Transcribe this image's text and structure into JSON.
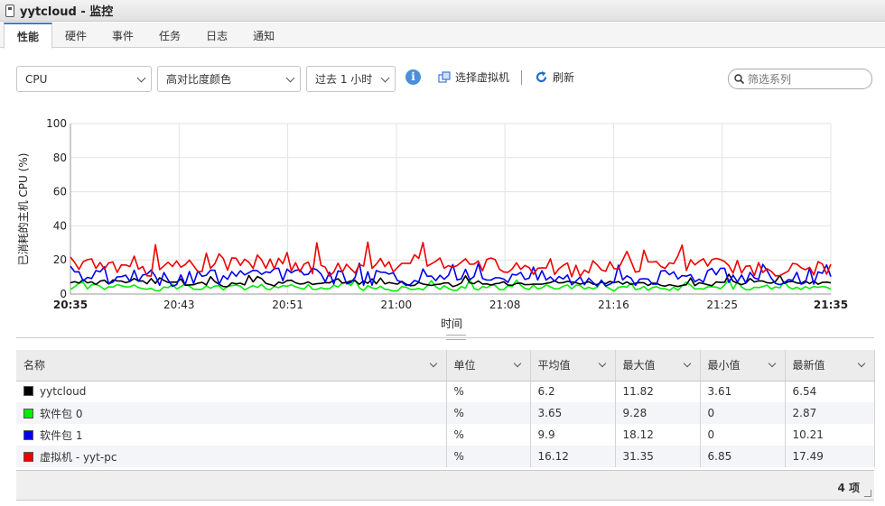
{
  "window": {
    "title": "yytcloud - 监控"
  },
  "tabs": [
    {
      "label": "性能",
      "active": true
    },
    {
      "label": "硬件"
    },
    {
      "label": "事件"
    },
    {
      "label": "任务"
    },
    {
      "label": "日志"
    },
    {
      "label": "通知"
    }
  ],
  "toolbar": {
    "metric_select": "CPU",
    "color_select": "高对比度颜色",
    "range_select": "过去 1 小时",
    "select_vm_label": "选择虚拟机",
    "refresh_label": "刷新",
    "search_placeholder": "筛选系列"
  },
  "chart_data": {
    "type": "line",
    "ylabel": "已消耗的主机 CPU (%)",
    "xlabel": "时间",
    "ylim": [
      0,
      100
    ],
    "yticks": [
      "0",
      "20",
      "40",
      "60",
      "80",
      "100"
    ],
    "xticks": [
      "20:35",
      "20:43",
      "20:51",
      "21:00",
      "21:08",
      "21:16",
      "21:25",
      "21:35"
    ],
    "grid": true,
    "series": [
      {
        "name": "yytcloud",
        "color": "#000000",
        "summary": {
          "avg": 6.2,
          "max": 11.82,
          "min": 3.61,
          "latest": 6.54
        }
      },
      {
        "name": "软件包 0",
        "color": "#00ee00",
        "summary": {
          "avg": 3.65,
          "max": 9.28,
          "min": 0,
          "latest": 2.87
        }
      },
      {
        "name": "软件包 1",
        "color": "#0000ee",
        "summary": {
          "avg": 9.9,
          "max": 18.12,
          "min": 0,
          "latest": 10.21
        }
      },
      {
        "name": "虚拟机 - yyt-pc",
        "color": "#ee0000",
        "summary": {
          "avg": 16.12,
          "max": 31.35,
          "min": 6.85,
          "latest": 17.49
        }
      }
    ]
  },
  "table": {
    "columns": [
      "名称",
      "单位",
      "平均值",
      "最大值",
      "最小值",
      "最新值"
    ],
    "rows": [
      {
        "name": "yytcloud",
        "color": "#000000",
        "unit": "%",
        "avg": "6.2",
        "max": "11.82",
        "min": "3.61",
        "latest": "6.54"
      },
      {
        "name": "软件包 0",
        "color": "#00ee00",
        "unit": "%",
        "avg": "3.65",
        "max": "9.28",
        "min": "0",
        "latest": "2.87"
      },
      {
        "name": "软件包 1",
        "color": "#0000ee",
        "unit": "%",
        "avg": "9.9",
        "max": "18.12",
        "min": "0",
        "latest": "10.21"
      },
      {
        "name": "虚拟机 - yyt-pc",
        "color": "#ee0000",
        "unit": "%",
        "avg": "16.12",
        "max": "31.35",
        "min": "6.85",
        "latest": "17.49"
      }
    ],
    "footer_count": "4 项"
  }
}
